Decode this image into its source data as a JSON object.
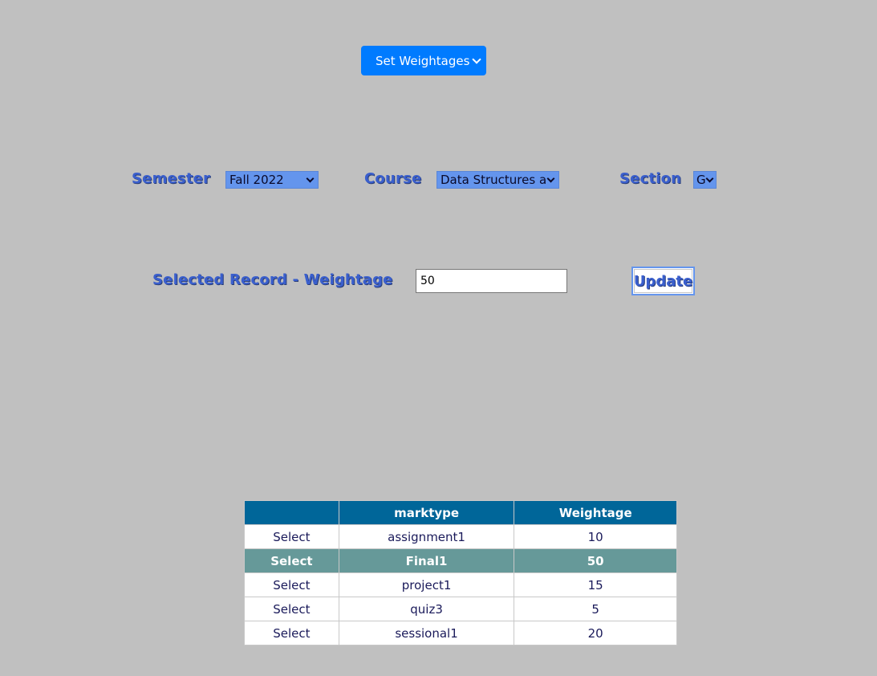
{
  "top_menu": {
    "selected": "Set Weightages"
  },
  "filters": {
    "semester_label": "Semester",
    "semester_value": "Fall 2022",
    "course_label": "Course",
    "course_value": "Data Structures and",
    "section_label": "Section",
    "section_value": "G"
  },
  "record": {
    "label": "Selected Record - Weightage",
    "value": "50",
    "update_label": "Update"
  },
  "table": {
    "headers": [
      "",
      "marktype",
      "Weightage"
    ],
    "selected_row_index": 1,
    "rows": [
      {
        "action": "Select",
        "marktype": "assignment1",
        "weightage": "10"
      },
      {
        "action": "Select",
        "marktype": "Final1",
        "weightage": "50"
      },
      {
        "action": "Select",
        "marktype": "project1",
        "weightage": "15"
      },
      {
        "action": "Select",
        "marktype": "quiz3",
        "weightage": "5"
      },
      {
        "action": "Select",
        "marktype": "sessional1",
        "weightage": "20"
      }
    ]
  },
  "colors": {
    "page_bg": "#c0c0c0",
    "primary_button": "#007bff",
    "select_bg": "#6495ed",
    "label_text": "#3a5fcd",
    "table_header": "#006699",
    "selected_row": "#669999"
  }
}
